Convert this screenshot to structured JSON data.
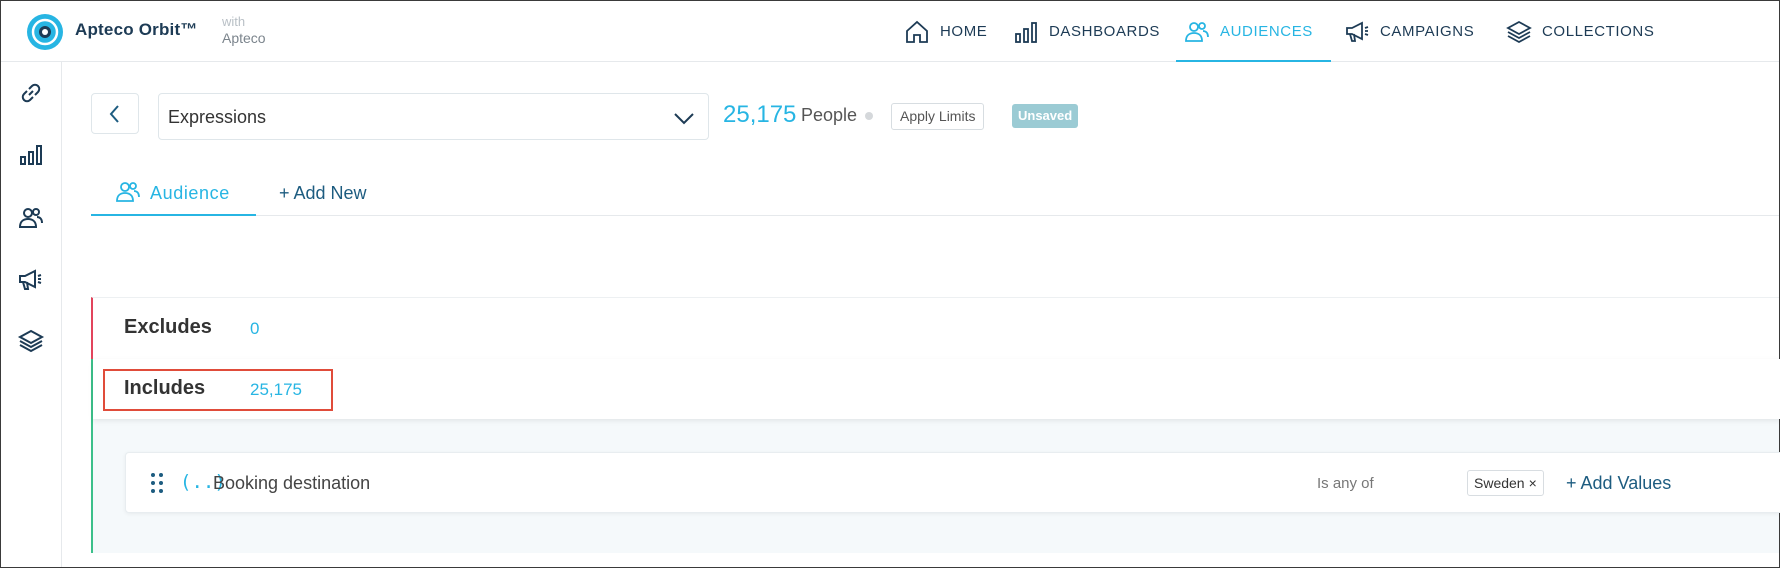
{
  "header": {
    "brand": "Apteco Orbit™",
    "with_top": "with",
    "with_bottom": "Apteco",
    "nav": [
      {
        "label": "HOME",
        "icon": "home-icon"
      },
      {
        "label": "DASHBOARDS",
        "icon": "bar-chart-icon"
      },
      {
        "label": "AUDIENCES",
        "icon": "people-icon",
        "active": true
      },
      {
        "label": "CAMPAIGNS",
        "icon": "megaphone-icon"
      },
      {
        "label": "COLLECTIONS",
        "icon": "layers-icon"
      }
    ]
  },
  "sidebar": {
    "icons": [
      "link-icon",
      "bar-chart-icon",
      "people-icon",
      "megaphone-icon",
      "layers-icon"
    ]
  },
  "toolbar": {
    "selection": "Expressions",
    "count": "25,175",
    "count_label": "People",
    "apply_limits": "Apply Limits",
    "status": "Unsaved"
  },
  "tabs": {
    "audience": "Audience",
    "add_new": "+ Add New"
  },
  "excludes": {
    "title": "Excludes",
    "count": "0"
  },
  "includes": {
    "title": "Includes",
    "count": "25,175",
    "rule": {
      "icon_text": "(..)",
      "label": "Booking destination",
      "operator": "Is any of",
      "value_chip": "Sweden",
      "chip_remove": "×",
      "add_values": "+ Add Values"
    }
  },
  "colors": {
    "accent": "#27b5e3",
    "navy": "#1d3b55",
    "exclude": "#e2445c",
    "include": "#3cc08a",
    "badge": "#9bcbd4"
  }
}
